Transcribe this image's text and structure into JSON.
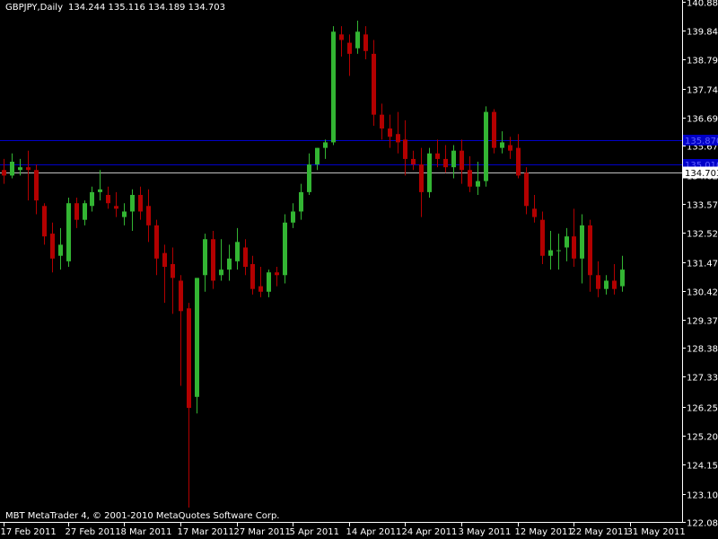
{
  "header": {
    "symbol_timeframe": "GBPJPY,Daily",
    "ohlc": "134.244 135.116 134.189 134.703"
  },
  "copyright": "MBT MetaTrader 4, © 2001-2010 MetaQuotes Software Corp.",
  "colors": {
    "background": "#000000",
    "axis": "#ffffff",
    "bull": "#33b533",
    "bear": "#b30000",
    "hline": "#0000c8",
    "price_line": "#c0c0c0"
  },
  "chart_data": {
    "type": "candlestick",
    "symbol": "GBPJPY",
    "timeframe": "Daily",
    "ylim": [
      122.08,
      140.88
    ],
    "y_ticks": [
      140.88,
      139.84,
      138.79,
      137.74,
      136.69,
      135.67,
      134.62,
      133.57,
      132.52,
      131.47,
      130.42,
      129.37,
      128.38,
      127.33,
      126.25,
      125.2,
      124.15,
      123.1,
      122.08
    ],
    "x_labels": [
      {
        "label": "17 Feb 2011",
        "index": 0
      },
      {
        "label": "27 Feb 2011",
        "index": 8
      },
      {
        "label": "8 Mar 2011",
        "index": 15
      },
      {
        "label": "17 Mar 2011",
        "index": 22
      },
      {
        "label": "27 Mar 2011",
        "index": 29
      },
      {
        "label": "5 Apr 2011",
        "index": 36
      },
      {
        "label": "14 Apr 2011",
        "index": 43
      },
      {
        "label": "24 Apr 2011",
        "index": 50
      },
      {
        "label": "3 May 2011",
        "index": 57
      },
      {
        "label": "12 May 2011",
        "index": 64
      },
      {
        "label": "22 May 2011",
        "index": 71
      },
      {
        "label": "31 May 2011",
        "index": 78
      }
    ],
    "horizontal_lines": [
      {
        "value": 135.87,
        "label": "135.870",
        "style": "blue"
      },
      {
        "value": 135.01,
        "label": "135.010",
        "style": "blue"
      },
      {
        "value": 134.703,
        "label": "134.703",
        "style": "current"
      }
    ],
    "candles": [
      {
        "o": 134.8,
        "h": 135.2,
        "l": 134.3,
        "c": 134.6
      },
      {
        "o": 134.6,
        "h": 135.4,
        "l": 134.5,
        "c": 135.1
      },
      {
        "o": 134.8,
        "h": 135.2,
        "l": 134.6,
        "c": 134.9
      },
      {
        "o": 134.9,
        "h": 135.5,
        "l": 133.7,
        "c": 134.8
      },
      {
        "o": 134.8,
        "h": 135.0,
        "l": 133.2,
        "c": 133.7
      },
      {
        "o": 133.5,
        "h": 133.6,
        "l": 132.1,
        "c": 132.4
      },
      {
        "o": 132.5,
        "h": 132.9,
        "l": 131.1,
        "c": 131.6
      },
      {
        "o": 131.7,
        "h": 132.7,
        "l": 131.2,
        "c": 132.1
      },
      {
        "o": 131.5,
        "h": 133.8,
        "l": 131.3,
        "c": 133.6
      },
      {
        "o": 133.6,
        "h": 133.8,
        "l": 132.7,
        "c": 133.0
      },
      {
        "o": 133.0,
        "h": 133.7,
        "l": 132.8,
        "c": 133.6
      },
      {
        "o": 133.5,
        "h": 134.2,
        "l": 133.3,
        "c": 134.0
      },
      {
        "o": 134.0,
        "h": 134.8,
        "l": 133.7,
        "c": 134.1
      },
      {
        "o": 133.9,
        "h": 134.2,
        "l": 133.4,
        "c": 133.6
      },
      {
        "o": 133.5,
        "h": 134.0,
        "l": 133.1,
        "c": 133.4
      },
      {
        "o": 133.1,
        "h": 133.6,
        "l": 132.8,
        "c": 133.3
      },
      {
        "o": 133.3,
        "h": 134.1,
        "l": 132.6,
        "c": 133.9
      },
      {
        "o": 133.9,
        "h": 134.2,
        "l": 133.0,
        "c": 133.3
      },
      {
        "o": 133.5,
        "h": 134.1,
        "l": 132.2,
        "c": 132.8
      },
      {
        "o": 132.8,
        "h": 133.0,
        "l": 131.0,
        "c": 131.6
      },
      {
        "o": 131.8,
        "h": 132.1,
        "l": 130.0,
        "c": 131.3
      },
      {
        "o": 131.4,
        "h": 132.0,
        "l": 129.6,
        "c": 130.9
      },
      {
        "o": 130.8,
        "h": 131.0,
        "l": 127.0,
        "c": 129.7
      },
      {
        "o": 129.8,
        "h": 130.0,
        "l": 122.6,
        "c": 126.2
      },
      {
        "o": 126.6,
        "h": 130.9,
        "l": 126.0,
        "c": 130.9
      },
      {
        "o": 131.0,
        "h": 132.5,
        "l": 130.4,
        "c": 132.3
      },
      {
        "o": 132.3,
        "h": 132.6,
        "l": 130.5,
        "c": 130.8
      },
      {
        "o": 131.0,
        "h": 132.3,
        "l": 130.8,
        "c": 131.2
      },
      {
        "o": 131.2,
        "h": 132.1,
        "l": 130.8,
        "c": 131.6
      },
      {
        "o": 131.5,
        "h": 132.7,
        "l": 131.2,
        "c": 132.2
      },
      {
        "o": 132.0,
        "h": 132.3,
        "l": 131.0,
        "c": 131.3
      },
      {
        "o": 131.4,
        "h": 131.7,
        "l": 130.3,
        "c": 130.5
      },
      {
        "o": 130.6,
        "h": 131.3,
        "l": 130.2,
        "c": 130.4
      },
      {
        "o": 130.4,
        "h": 131.2,
        "l": 130.2,
        "c": 131.1
      },
      {
        "o": 131.1,
        "h": 131.3,
        "l": 130.6,
        "c": 131.0
      },
      {
        "o": 131.0,
        "h": 133.2,
        "l": 130.7,
        "c": 132.9
      },
      {
        "o": 132.9,
        "h": 133.6,
        "l": 132.7,
        "c": 133.3
      },
      {
        "o": 133.3,
        "h": 134.3,
        "l": 133.0,
        "c": 134.0
      },
      {
        "o": 134.0,
        "h": 135.4,
        "l": 133.9,
        "c": 135.0
      },
      {
        "o": 135.0,
        "h": 135.6,
        "l": 134.8,
        "c": 135.6
      },
      {
        "o": 135.6,
        "h": 135.9,
        "l": 135.2,
        "c": 135.8
      },
      {
        "o": 135.8,
        "h": 140.0,
        "l": 135.7,
        "c": 139.8
      },
      {
        "o": 139.7,
        "h": 140.0,
        "l": 138.9,
        "c": 139.5
      },
      {
        "o": 139.4,
        "h": 139.7,
        "l": 138.2,
        "c": 139.0
      },
      {
        "o": 139.2,
        "h": 140.2,
        "l": 139.0,
        "c": 139.8
      },
      {
        "o": 139.7,
        "h": 140.0,
        "l": 138.8,
        "c": 139.1
      },
      {
        "o": 139.0,
        "h": 139.5,
        "l": 136.4,
        "c": 136.8
      },
      {
        "o": 136.8,
        "h": 137.2,
        "l": 135.9,
        "c": 136.3
      },
      {
        "o": 136.3,
        "h": 136.8,
        "l": 135.6,
        "c": 136.0
      },
      {
        "o": 136.1,
        "h": 136.9,
        "l": 135.4,
        "c": 135.8
      },
      {
        "o": 135.9,
        "h": 136.6,
        "l": 134.6,
        "c": 135.2
      },
      {
        "o": 135.2,
        "h": 135.5,
        "l": 134.8,
        "c": 135.0
      },
      {
        "o": 135.0,
        "h": 135.6,
        "l": 133.1,
        "c": 134.0
      },
      {
        "o": 134.0,
        "h": 135.6,
        "l": 133.8,
        "c": 135.4
      },
      {
        "o": 135.4,
        "h": 135.9,
        "l": 134.9,
        "c": 135.2
      },
      {
        "o": 135.2,
        "h": 135.7,
        "l": 134.7,
        "c": 134.9
      },
      {
        "o": 134.9,
        "h": 135.7,
        "l": 134.5,
        "c": 135.5
      },
      {
        "o": 135.5,
        "h": 135.9,
        "l": 134.3,
        "c": 134.8
      },
      {
        "o": 134.8,
        "h": 135.3,
        "l": 134.0,
        "c": 134.2
      },
      {
        "o": 134.2,
        "h": 135.1,
        "l": 133.9,
        "c": 134.4
      },
      {
        "o": 134.4,
        "h": 137.1,
        "l": 134.2,
        "c": 136.9
      },
      {
        "o": 136.9,
        "h": 137.0,
        "l": 135.4,
        "c": 135.6
      },
      {
        "o": 135.6,
        "h": 136.2,
        "l": 135.4,
        "c": 135.8
      },
      {
        "o": 135.7,
        "h": 136.0,
        "l": 135.2,
        "c": 135.5
      },
      {
        "o": 135.6,
        "h": 136.1,
        "l": 134.5,
        "c": 134.6
      },
      {
        "o": 134.7,
        "h": 134.9,
        "l": 133.2,
        "c": 133.5
      },
      {
        "o": 133.4,
        "h": 133.9,
        "l": 132.9,
        "c": 133.1
      },
      {
        "o": 133.0,
        "h": 133.3,
        "l": 131.4,
        "c": 131.7
      },
      {
        "o": 131.7,
        "h": 132.6,
        "l": 131.2,
        "c": 131.9
      },
      {
        "o": 131.9,
        "h": 132.5,
        "l": 131.2,
        "c": 131.9
      },
      {
        "o": 132.0,
        "h": 132.7,
        "l": 131.5,
        "c": 132.4
      },
      {
        "o": 132.4,
        "h": 133.4,
        "l": 131.3,
        "c": 131.6
      },
      {
        "o": 131.6,
        "h": 133.2,
        "l": 130.7,
        "c": 132.8
      },
      {
        "o": 132.8,
        "h": 133.0,
        "l": 130.4,
        "c": 131.0
      },
      {
        "o": 131.0,
        "h": 131.5,
        "l": 130.2,
        "c": 130.5
      },
      {
        "o": 130.5,
        "h": 131.0,
        "l": 130.3,
        "c": 130.8
      },
      {
        "o": 130.8,
        "h": 131.4,
        "l": 130.3,
        "c": 130.5
      },
      {
        "o": 130.6,
        "h": 131.7,
        "l": 130.4,
        "c": 131.2
      }
    ]
  }
}
